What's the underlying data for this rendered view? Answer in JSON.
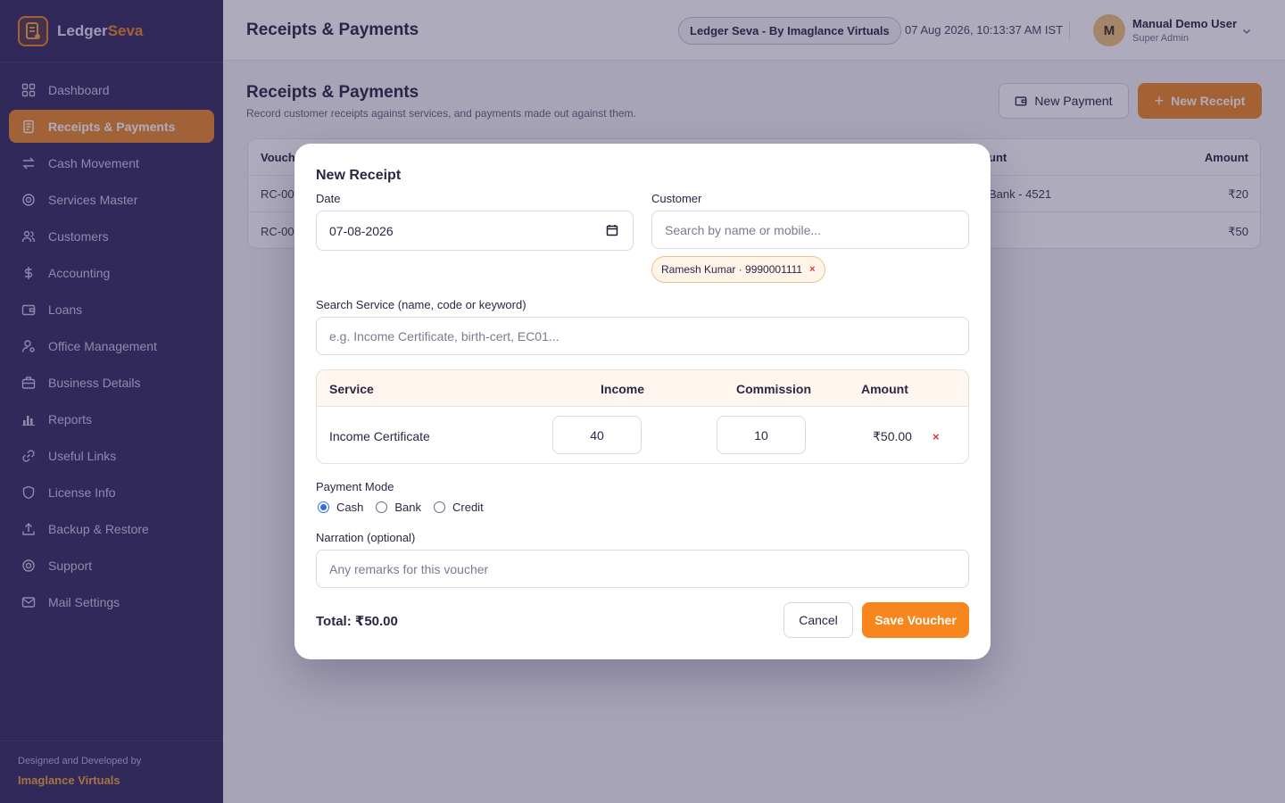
{
  "brand": {
    "name_part1": "Ledger",
    "name_part2": "Seva"
  },
  "sidebar": {
    "items": [
      {
        "label": "Dashboard",
        "icon": "grid-icon"
      },
      {
        "label": "Receipts & Payments",
        "icon": "receipt-icon",
        "active": true
      },
      {
        "label": "Cash Movement",
        "icon": "transfer-icon"
      },
      {
        "label": "Services Master",
        "icon": "gear-icon"
      },
      {
        "label": "Customers",
        "icon": "users-icon"
      },
      {
        "label": "Accounting",
        "icon": "dollar-icon"
      },
      {
        "label": "Loans",
        "icon": "wallet-icon"
      },
      {
        "label": "Office Management",
        "icon": "user-cog-icon"
      },
      {
        "label": "Business Details",
        "icon": "briefcase-icon"
      },
      {
        "label": "Reports",
        "icon": "bar-chart-icon"
      },
      {
        "label": "Useful Links",
        "icon": "link-icon"
      },
      {
        "label": "License Info",
        "icon": "shield-icon"
      },
      {
        "label": "Backup & Restore",
        "icon": "upload-icon"
      },
      {
        "label": "Support",
        "icon": "support-icon"
      },
      {
        "label": "Mail Settings",
        "icon": "mail-icon"
      }
    ],
    "footer_small": "Designed and Developed by",
    "footer_company": "Imaglance Virtuals"
  },
  "header": {
    "title": "Receipts & Payments",
    "badge": "Ledger Seva - By Imaglance Virtuals",
    "datetime": "07 Aug 2026, 10:13:37 AM IST",
    "avatar_initial": "M",
    "user_name": "Manual Demo User",
    "user_role": "Super Admin"
  },
  "page": {
    "title": "Receipts & Payments",
    "subtitle": "Record customer receipts against services, and payments made out against them.",
    "new_payment_label": "New Payment",
    "new_receipt_label": "New Receipt",
    "table": {
      "col_voucher": "Vouch",
      "col_account": "unt",
      "col_amount": "Amount",
      "rows": [
        {
          "voucher": "RC-00",
          "account": "Bank - 4521",
          "amount": "₹20"
        },
        {
          "voucher": "RC-00",
          "account": "",
          "amount": "₹50"
        }
      ]
    }
  },
  "modal": {
    "title": "New Receipt",
    "date_label": "Date",
    "date_value": "07-08-2026",
    "customer_label": "Customer",
    "customer_placeholder": "Search by name or mobile...",
    "customer_chip": "Ramesh Kumar · 9990001111",
    "chip_remove": "×",
    "service_search_label": "Search Service (name, code or keyword)",
    "service_search_placeholder": "e.g. Income Certificate, birth-cert, EC01...",
    "services_table": {
      "headers": {
        "service": "Service",
        "income": "Income",
        "commission": "Commission",
        "amount": "Amount"
      },
      "rows": [
        {
          "service": "Income Certificate",
          "income": "40",
          "commission": "10",
          "amount": "₹50.00",
          "remove": "×"
        }
      ]
    },
    "payment_mode_label": "Payment Mode",
    "payment_modes": [
      {
        "label": "Cash",
        "checked": true
      },
      {
        "label": "Bank",
        "checked": false
      },
      {
        "label": "Credit",
        "checked": false
      }
    ],
    "narration_label": "Narration (optional)",
    "narration_placeholder": "Any remarks for this voucher",
    "total_text": "Total: ₹50.00",
    "cancel_label": "Cancel",
    "save_label": "Save Voucher"
  },
  "colors": {
    "sidebar_bg": "#362e5f",
    "accent": "#f08a24",
    "overlay": "rgba(40,34,78,0.38)",
    "remove": "#d8353a"
  }
}
